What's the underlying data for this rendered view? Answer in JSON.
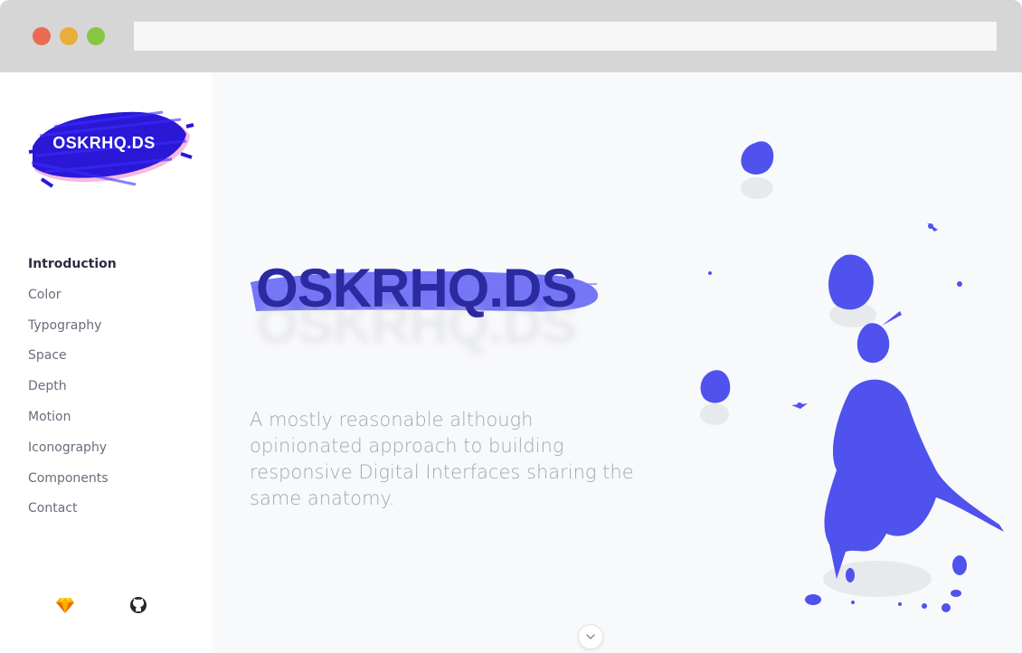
{
  "brand": {
    "logo_text": "OSKRHQ.DS",
    "accent": "#4f4ff0",
    "logo_blue": "#2a18d6",
    "logo_pink": "#f6a7d6"
  },
  "hero": {
    "title": "OSKRHQ.DS",
    "tagline": "A mostly reasonable although opinionated approach to building responsive Digital Interfaces sharing the same anatomy."
  },
  "nav": {
    "items": [
      {
        "label": "Introduction"
      },
      {
        "label": "Color"
      },
      {
        "label": "Typography"
      },
      {
        "label": "Space"
      },
      {
        "label": "Depth"
      },
      {
        "label": "Motion"
      },
      {
        "label": "Iconography"
      },
      {
        "label": "Components"
      },
      {
        "label": "Contact"
      }
    ],
    "active": "Introduction"
  },
  "footer_icons": {
    "sketch": "sketch-icon",
    "github": "github-icon"
  },
  "scroll_icon": "chevron-down-icon",
  "window": {
    "controls": [
      "close",
      "minimize",
      "maximize"
    ],
    "colors": {
      "close": "#ec6a52",
      "minimize": "#e9ad3a",
      "maximize": "#87c643"
    }
  }
}
